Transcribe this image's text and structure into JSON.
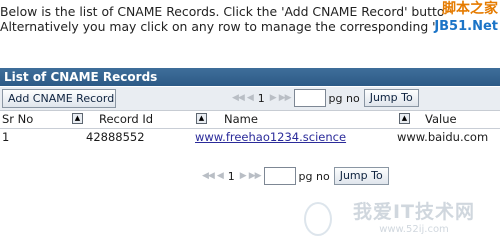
{
  "intro": {
    "line1": "Below is the list of CNAME Records. Click the 'Add CNAME Record' butto",
    "line2": "Alternatively you may click on any row to manage the corresponding '"
  },
  "watermark_top": {
    "cn": "脚本之家",
    "en": "JB51.Net"
  },
  "section": {
    "title": "List of CNAME Records"
  },
  "toolbar": {
    "add_label": "Add CNAME Record"
  },
  "pager": {
    "first_icon": "double-left-arrow",
    "prev_icon": "left-arrow",
    "next_icon": "right-arrow",
    "last_icon": "double-right-arrow",
    "page_number": "1",
    "page_input_value": "",
    "page_label": "pg no",
    "jump_label": "Jump To"
  },
  "table": {
    "columns": [
      {
        "label": "Sr No"
      },
      {
        "label": "Record Id"
      },
      {
        "label": "Name"
      },
      {
        "label": "Value"
      }
    ],
    "sort_icon": "sort-icon",
    "rows": [
      {
        "sr_no": "1",
        "record_id": "42888552",
        "name": "www.freehao1234.science",
        "value": "www.baidu.com"
      }
    ]
  },
  "watermark_bottom": {
    "cn": "我爱IT技术网",
    "en": "www.52ij.com"
  },
  "colors": {
    "header_bar": "#2c5a86",
    "link": "#2b2b9a",
    "toolbar_bg": "#e9edf2"
  }
}
